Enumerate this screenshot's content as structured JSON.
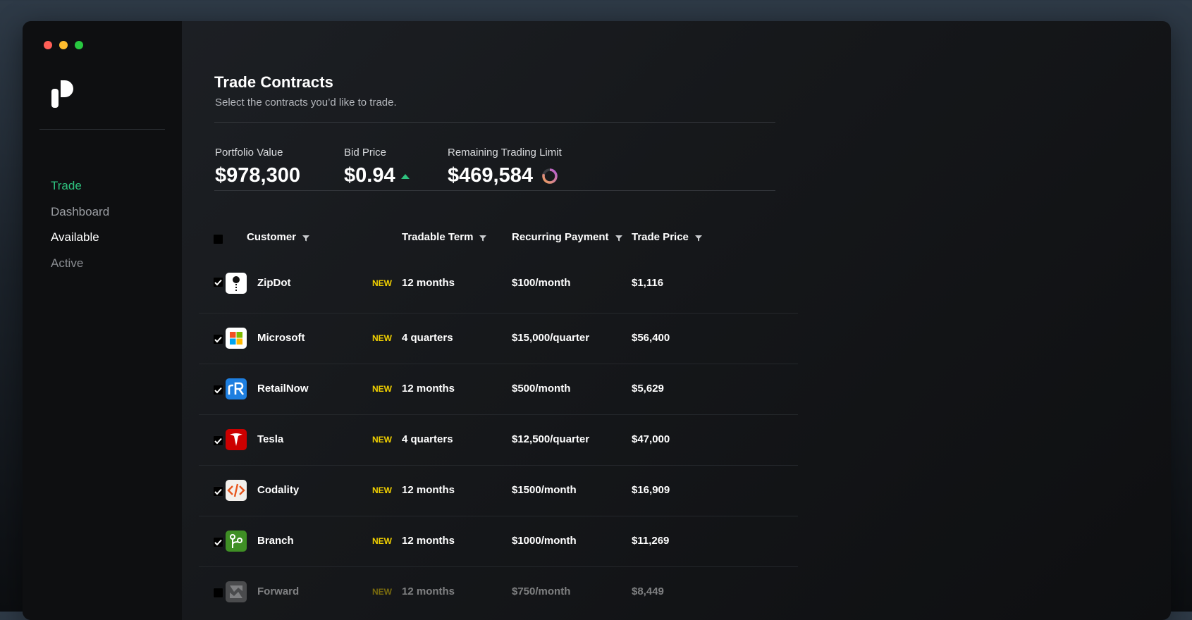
{
  "sidebar": {
    "nav": [
      {
        "label": "Trade",
        "color": "#2ec27e"
      },
      {
        "label": "Dashboard",
        "color": "#9a9da2"
      },
      {
        "label": "Available",
        "color": "#ffffff"
      },
      {
        "label": "Active",
        "color": "#8b8e93"
      }
    ]
  },
  "header": {
    "title": "Trade Contracts",
    "subtitle": "Select the contracts you’d like to trade."
  },
  "stats": {
    "portfolio_value": {
      "label": "Portfolio Value",
      "value": "$978,300"
    },
    "bid_price": {
      "label": "Bid Price",
      "value": "$0.94",
      "trend": "up"
    },
    "trading_limit": {
      "label": "Remaining Trading Limit",
      "value": "$469,584"
    }
  },
  "table": {
    "columns": {
      "customer": "Customer",
      "term": "Tradable Term",
      "payment": "Recurring Payment",
      "price": "Trade Price"
    },
    "rows": [
      {
        "name": "ZipDot",
        "badge": "NEW",
        "term": "12 months",
        "payment": "$100/month",
        "price": "$1,116",
        "checked": true,
        "icon": "zipdot-logo-icon"
      },
      {
        "name": "Microsoft",
        "badge": "NEW",
        "term": "4 quarters",
        "payment": "$15,000/quarter",
        "price": "$56,400",
        "checked": true,
        "icon": "microsoft-logo-icon"
      },
      {
        "name": "RetailNow",
        "badge": "NEW",
        "term": "12 months",
        "payment": "$500/month",
        "price": "$5,629",
        "checked": true,
        "icon": "retailnow-logo-icon"
      },
      {
        "name": "Tesla",
        "badge": "NEW",
        "term": "4 quarters",
        "payment": "$12,500/quarter",
        "price": "$47,000",
        "checked": true,
        "icon": "tesla-logo-icon"
      },
      {
        "name": "Codality",
        "badge": "NEW",
        "term": "12 months",
        "payment": "$1500/month",
        "price": "$16,909",
        "checked": true,
        "icon": "codality-logo-icon"
      },
      {
        "name": "Branch",
        "badge": "NEW",
        "term": "12 months",
        "payment": "$1000/month",
        "price": "$11,269",
        "checked": true,
        "icon": "branch-logo-icon"
      },
      {
        "name": "Forward",
        "badge": "NEW",
        "term": "12 months",
        "payment": "$750/month",
        "price": "$8,449",
        "checked": false,
        "icon": "forward-logo-icon"
      }
    ]
  },
  "colors": {
    "accent_green": "#2ec27e",
    "badge_yellow": "#f2d100"
  }
}
